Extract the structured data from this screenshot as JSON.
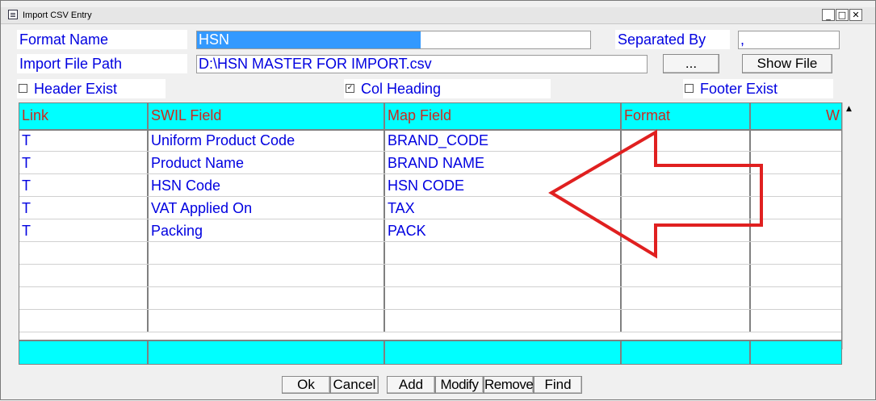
{
  "window": {
    "title": "Import CSV Entry",
    "controls": {
      "minimize": "_",
      "maximize": "□",
      "close": "✕"
    }
  },
  "form": {
    "format_name_label": "Format Name",
    "format_name_value": "HSN",
    "separated_by_label": "Separated By",
    "separated_by_value": ",",
    "import_path_label": "Import File Path",
    "import_path_value": "D:\\HSN MASTER FOR IMPORT.csv",
    "browse_label": "...",
    "show_file_label": "Show File",
    "header_exist_label": "Header Exist",
    "header_exist_checked": false,
    "col_heading_label": "Col Heading",
    "col_heading_checked": true,
    "footer_exist_label": "Footer Exist",
    "footer_exist_checked": false,
    "check_mark": "✓"
  },
  "grid": {
    "columns": [
      "Link",
      "SWIL Field",
      "Map Field",
      "Format",
      "W"
    ],
    "rows": [
      [
        "T",
        "Uniform Product Code",
        "BRAND_CODE",
        "",
        ""
      ],
      [
        "T",
        "Product Name",
        "BRAND NAME",
        "",
        ""
      ],
      [
        "T",
        "HSN Code",
        "HSN CODE",
        "",
        ""
      ],
      [
        "T",
        "VAT Applied On",
        "TAX",
        "",
        ""
      ],
      [
        "T",
        "Packing",
        "PACK",
        "",
        ""
      ],
      [
        "",
        "",
        "",
        "",
        ""
      ],
      [
        "",
        "",
        "",
        "",
        ""
      ],
      [
        "",
        "",
        "",
        "",
        ""
      ],
      [
        "",
        "",
        "",
        "",
        ""
      ]
    ],
    "scroll_up": "▲"
  },
  "buttons": {
    "ok": "Ok",
    "cancel": "Cancel",
    "add": "Add",
    "modify": "Modify",
    "remove": "Remove",
    "find": "Find"
  },
  "colors": {
    "label_text": "#0000e0",
    "header_bg": "#00ffff",
    "header_text": "#cc2a1f",
    "annotation_arrow": "#e02020"
  }
}
